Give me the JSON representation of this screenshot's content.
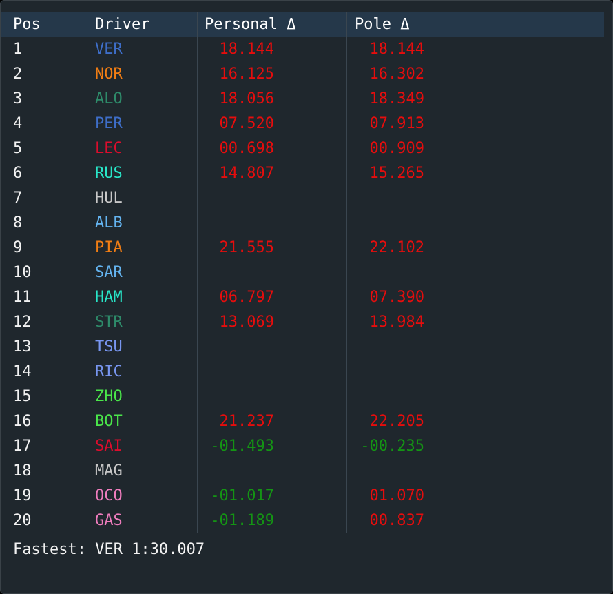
{
  "headers": {
    "pos": "Pos",
    "driver": "Driver",
    "personal": "Personal Δ",
    "pole": "Pole Δ"
  },
  "colors": {
    "slower": "#e60d0d",
    "faster": "#149414",
    "text": "#f2f2f2",
    "header_bg": "#25384a",
    "panel_bg": "#1f272d"
  },
  "rows": [
    {
      "pos": "1",
      "driver": "VER",
      "driver_color": "#3e6ec8",
      "personal": "18.144",
      "pole": "18.144"
    },
    {
      "pos": "2",
      "driver": "NOR",
      "driver_color": "#f07d14",
      "personal": "16.125",
      "pole": "16.302"
    },
    {
      "pos": "3",
      "driver": "ALO",
      "driver_color": "#2e8b6a",
      "personal": "18.056",
      "pole": "18.349"
    },
    {
      "pos": "4",
      "driver": "PER",
      "driver_color": "#3e6ec8",
      "personal": "07.520",
      "pole": "07.913"
    },
    {
      "pos": "5",
      "driver": "LEC",
      "driver_color": "#dc0d2d",
      "personal": "00.698",
      "pole": "00.909"
    },
    {
      "pos": "6",
      "driver": "RUS",
      "driver_color": "#28e6c8",
      "personal": "14.807",
      "pole": "15.265"
    },
    {
      "pos": "7",
      "driver": "HUL",
      "driver_color": "#c8c8c8",
      "personal": "",
      "pole": ""
    },
    {
      "pos": "8",
      "driver": "ALB",
      "driver_color": "#64b4f0",
      "personal": "",
      "pole": ""
    },
    {
      "pos": "9",
      "driver": "PIA",
      "driver_color": "#f07d14",
      "personal": "21.555",
      "pole": "22.102"
    },
    {
      "pos": "10",
      "driver": "SAR",
      "driver_color": "#64b4f0",
      "personal": "",
      "pole": ""
    },
    {
      "pos": "11",
      "driver": "HAM",
      "driver_color": "#28e6c8",
      "personal": "06.797",
      "pole": "07.390"
    },
    {
      "pos": "12",
      "driver": "STR",
      "driver_color": "#2e8b6a",
      "personal": "13.069",
      "pole": "13.984"
    },
    {
      "pos": "13",
      "driver": "TSU",
      "driver_color": "#7896f0",
      "personal": "",
      "pole": ""
    },
    {
      "pos": "14",
      "driver": "RIC",
      "driver_color": "#7896f0",
      "personal": "",
      "pole": ""
    },
    {
      "pos": "15",
      "driver": "ZHO",
      "driver_color": "#4ae64a",
      "personal": "",
      "pole": ""
    },
    {
      "pos": "16",
      "driver": "BOT",
      "driver_color": "#4ae64a",
      "personal": "21.237",
      "pole": "22.205"
    },
    {
      "pos": "17",
      "driver": "SAI",
      "driver_color": "#dc0d2d",
      "personal": "-01.493",
      "pole": "-00.235"
    },
    {
      "pos": "18",
      "driver": "MAG",
      "driver_color": "#c8c8c8",
      "personal": "",
      "pole": ""
    },
    {
      "pos": "19",
      "driver": "OCO",
      "driver_color": "#f07dbe",
      "personal": "-01.017",
      "pole": "01.070"
    },
    {
      "pos": "20",
      "driver": "GAS",
      "driver_color": "#f07dbe",
      "personal": "-01.189",
      "pole": "00.837"
    }
  ],
  "footer": {
    "text": "Fastest: VER 1:30.007"
  }
}
